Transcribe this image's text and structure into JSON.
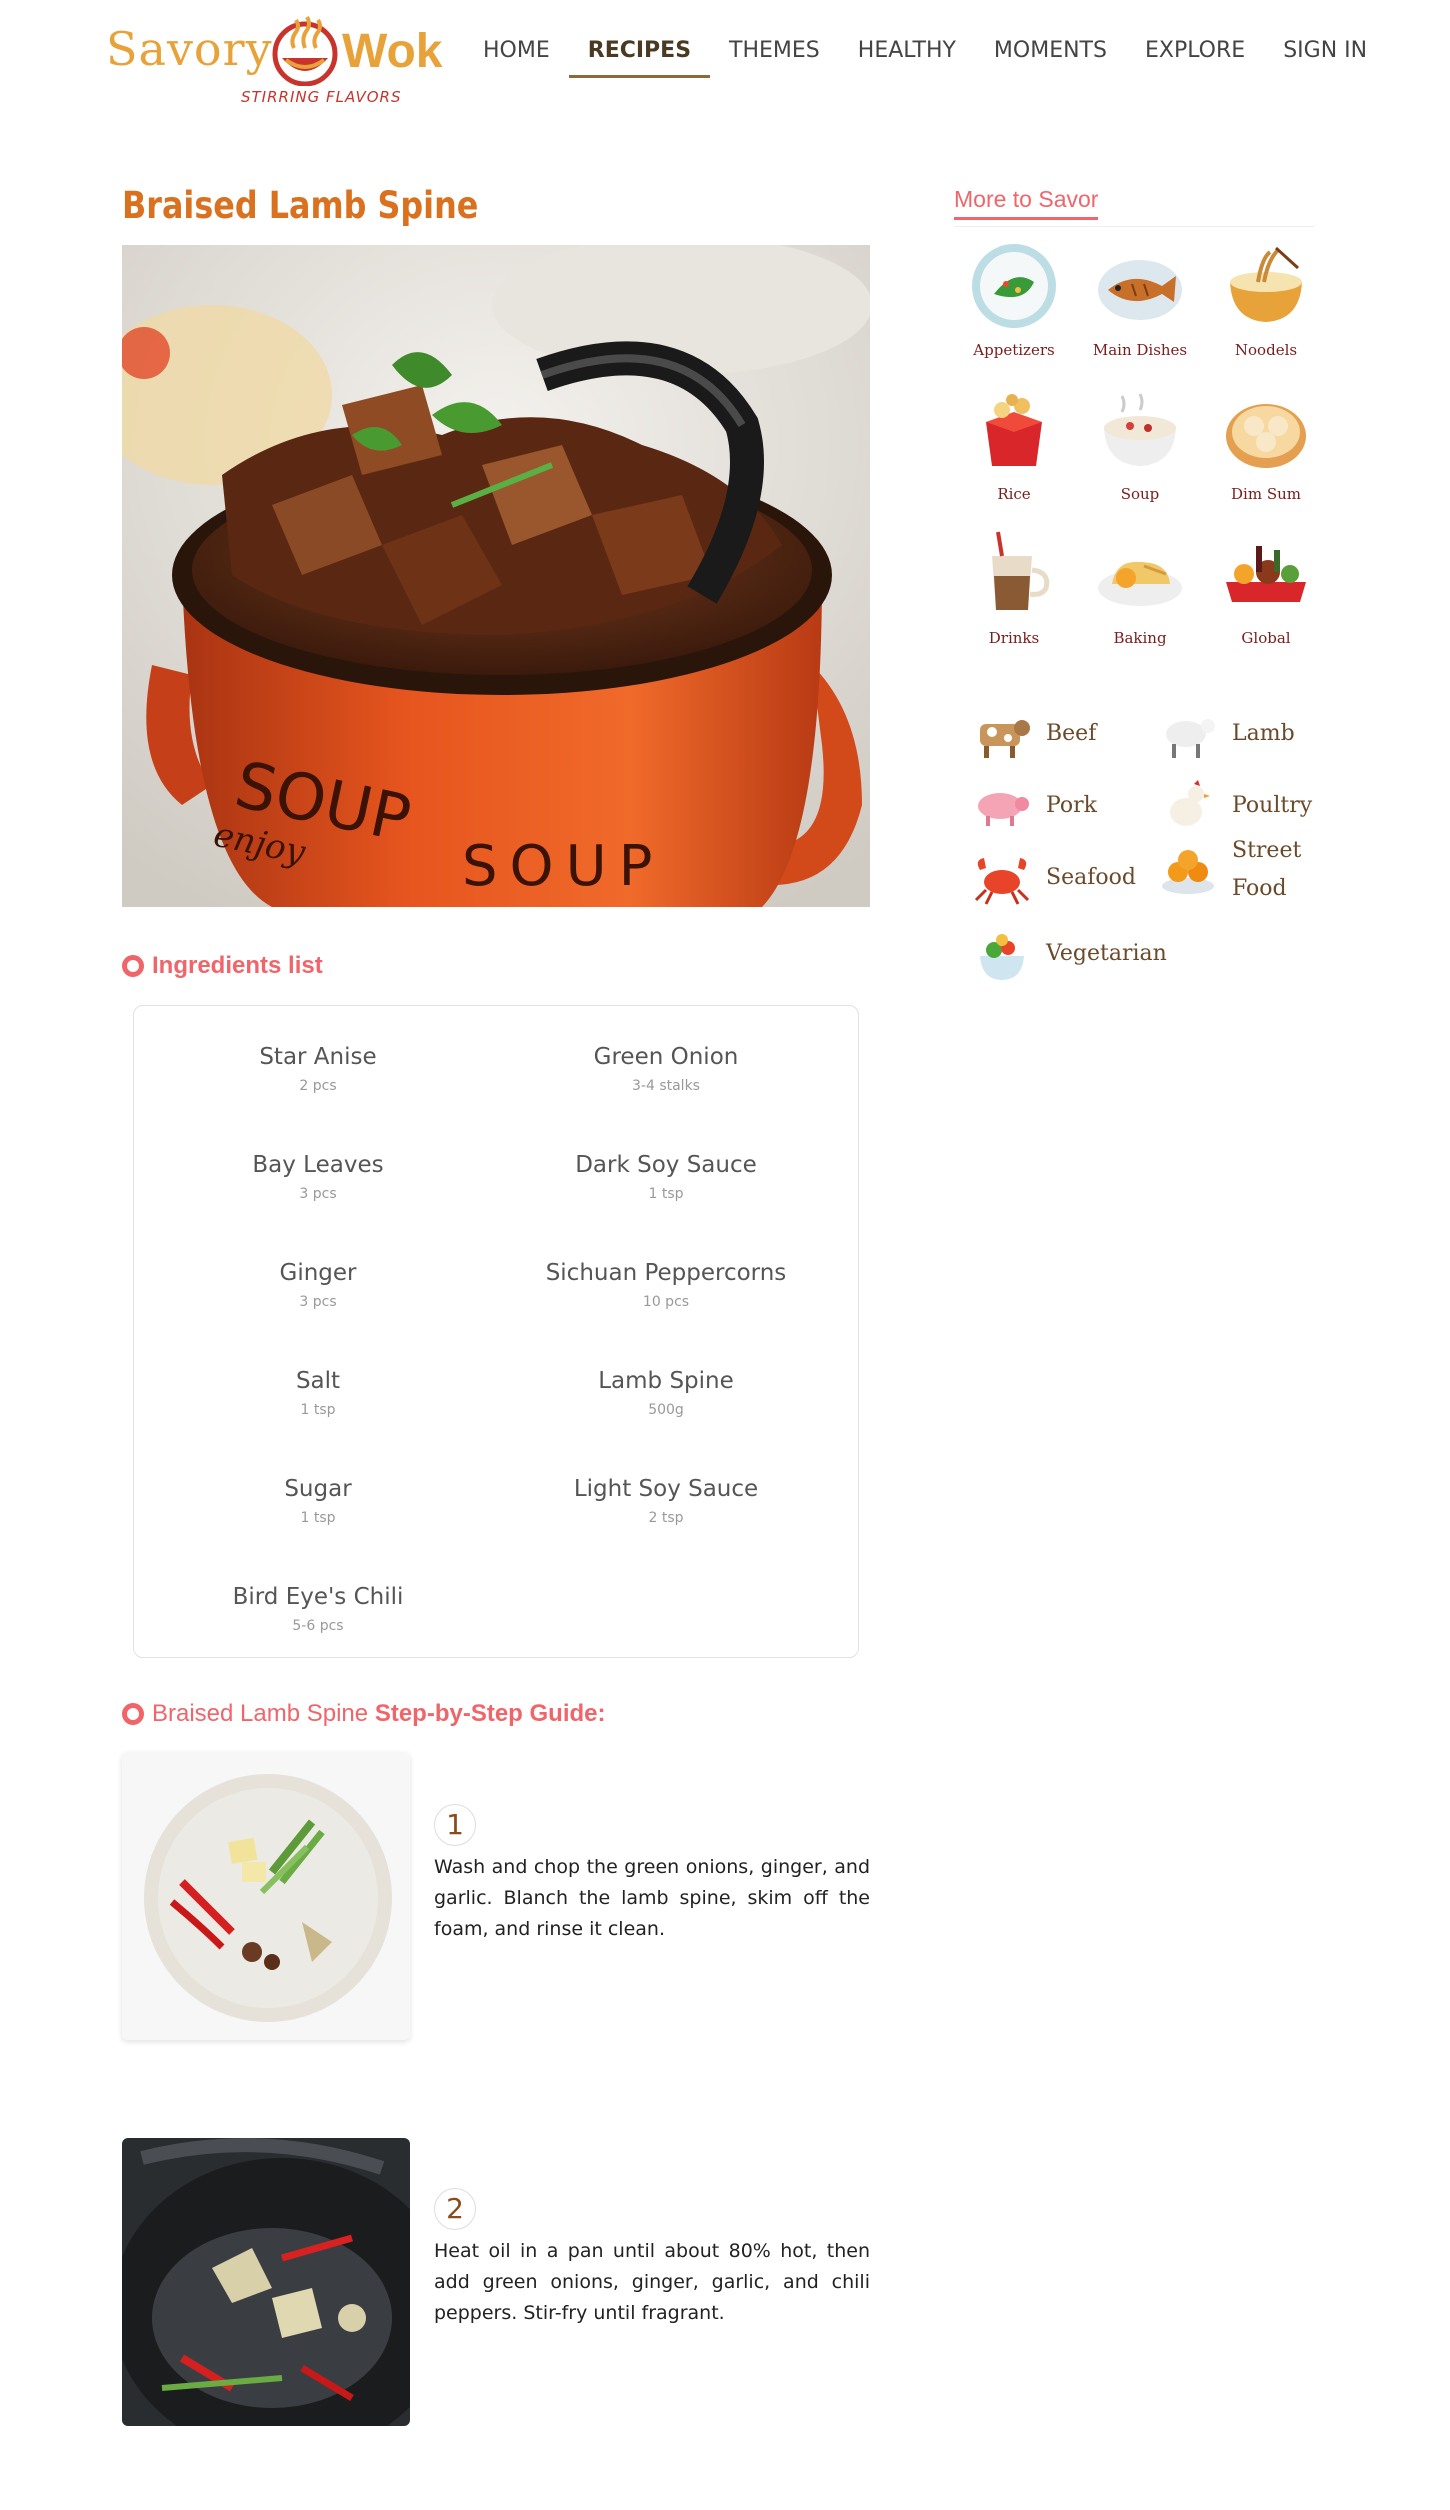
{
  "header": {
    "logo_left": "Savory",
    "logo_right": "Wok",
    "logo_tagline": "STIRRING FLAVORS",
    "nav": [
      {
        "label": "HOME",
        "active": false
      },
      {
        "label": "RECIPES",
        "active": true
      },
      {
        "label": "THEMES",
        "active": false
      },
      {
        "label": "HEALTHY",
        "active": false
      },
      {
        "label": "MOMENTS",
        "active": false
      },
      {
        "label": "EXPLORE",
        "active": false
      },
      {
        "label": "SIGN IN",
        "active": false
      }
    ]
  },
  "recipe": {
    "title": "Braised Lamb Spine",
    "hero_pot_text": "SOUP SOUP",
    "hero_pot_subtext": "enjoy"
  },
  "ingredients": {
    "heading": "Ingredients list",
    "items": [
      {
        "name": "Star Anise",
        "amount": "2 pcs"
      },
      {
        "name": "Green Onion",
        "amount": "3-4 stalks"
      },
      {
        "name": "Bay Leaves",
        "amount": "3 pcs"
      },
      {
        "name": "Dark Soy Sauce",
        "amount": "1 tsp"
      },
      {
        "name": "Ginger",
        "amount": "3 pcs"
      },
      {
        "name": "Sichuan Peppercorns",
        "amount": "10 pcs"
      },
      {
        "name": "Salt",
        "amount": "1 tsp"
      },
      {
        "name": "Lamb Spine",
        "amount": "500g"
      },
      {
        "name": "Sugar",
        "amount": "1 tsp"
      },
      {
        "name": "Light Soy Sauce",
        "amount": "2 tsp"
      },
      {
        "name": "Bird Eye's Chili",
        "amount": "5-6 pcs"
      }
    ]
  },
  "steps": {
    "heading_recipe": "Braised Lamb Spine",
    "heading_suffix": "Step-by-Step Guide:",
    "items": [
      {
        "number": "1",
        "text": "Wash and chop the green onions, ginger, and garlic. Blanch the lamb spine, skim off the foam, and rinse it clean."
      },
      {
        "number": "2",
        "text": "Heat oil in a pan until about 80% hot, then add green onions, ginger, garlic, and chili peppers. Stir-fry until fragrant."
      }
    ]
  },
  "sidebar": {
    "title": "More to Savor",
    "categories": [
      {
        "label": "Appetizers",
        "icon": "appetizer-plate-icon"
      },
      {
        "label": "Main Dishes",
        "icon": "fish-dish-icon"
      },
      {
        "label": "Noodels",
        "icon": "noodle-bowl-icon"
      },
      {
        "label": "Rice",
        "icon": "rice-box-icon"
      },
      {
        "label": "Soup",
        "icon": "soup-bowl-icon"
      },
      {
        "label": "Dim Sum",
        "icon": "dim-sum-basket-icon"
      },
      {
        "label": "Drinks",
        "icon": "drink-cup-icon"
      },
      {
        "label": "Baking",
        "icon": "pastry-plate-icon"
      },
      {
        "label": "Global",
        "icon": "feast-table-icon"
      }
    ],
    "ingredients": [
      {
        "label": "Beef",
        "icon": "cow-icon"
      },
      {
        "label": "Lamb",
        "icon": "sheep-icon"
      },
      {
        "label": "Pork",
        "icon": "pig-icon"
      },
      {
        "label": "Poultry",
        "icon": "chicken-icon"
      },
      {
        "label": "Seafood",
        "icon": "crab-icon"
      },
      {
        "label": "Street Food",
        "icon": "street-food-icon"
      },
      {
        "label": "Vegetarian",
        "icon": "salad-icon"
      }
    ]
  }
}
